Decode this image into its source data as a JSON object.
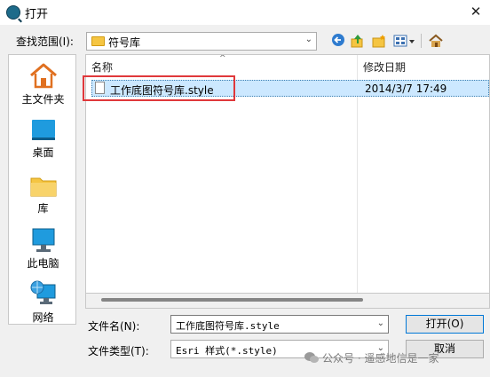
{
  "window": {
    "title": "打开",
    "close_glyph": "✕"
  },
  "look_in": {
    "label": "查找范围(I):",
    "value": "符号库"
  },
  "places": [
    {
      "label": "主文件夹",
      "icon": "home-icon"
    },
    {
      "label": "桌面",
      "icon": "desktop-icon"
    },
    {
      "label": "库",
      "icon": "library-icon"
    },
    {
      "label": "此电脑",
      "icon": "computer-icon"
    },
    {
      "label": "网络",
      "icon": "network-icon"
    }
  ],
  "columns": {
    "name": "名称",
    "modified": "修改日期"
  },
  "files": [
    {
      "name": "工作底图符号库.style",
      "modified": "2014/3/7 17:49"
    }
  ],
  "file_name": {
    "label": "文件名(N):",
    "value": "工作底图符号库.style"
  },
  "file_type": {
    "label": "文件类型(T):",
    "value": "Esri 样式(*.style)"
  },
  "buttons": {
    "open": "打开(O)",
    "cancel": "取消"
  },
  "watermark": "公众号 · 遥感地信是一家",
  "colors": {
    "selection": "#cce8ff",
    "highlight_box": "#e0383b",
    "folder": "#f5c542"
  }
}
